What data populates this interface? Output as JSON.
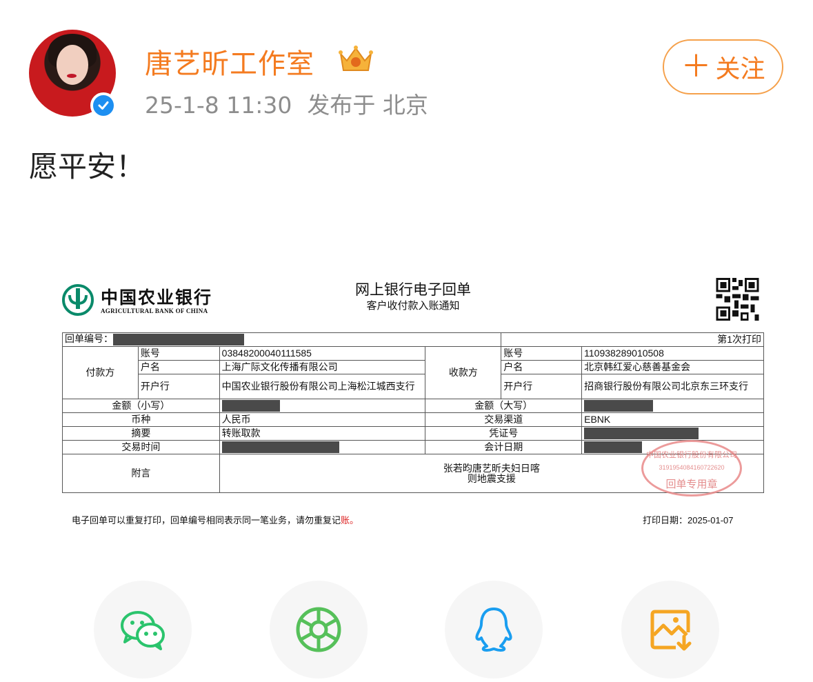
{
  "post": {
    "username": "唐艺昕工作室",
    "date": "25-1-8 11:30",
    "location": "发布于 北京",
    "follow_label": "关注",
    "follow_plus": "＋",
    "text": "愿平安！"
  },
  "icons": {
    "verified": "verified-badge-icon",
    "crown": "crown-badge-icon",
    "share": [
      "wechat-icon",
      "moments-icon",
      "qq-icon",
      "save-image-icon"
    ]
  },
  "colors": {
    "username": "#f47b20",
    "verified": "#1d8ff1",
    "wechat": "#2bc46d",
    "moments": "#56c05a",
    "qq": "#1a9ef0",
    "save": "#f5a623"
  },
  "receipt": {
    "bank_cn": "中国农业银行",
    "bank_en": "AGRICULTURAL BANK OF CHINA",
    "title": "网上银行电子回单",
    "subtitle": "客户收付款入账通知",
    "receipt_no_label": "回单编号：",
    "print_count": "第1次打印",
    "payer_label": "付款方",
    "payee_label": "收款方",
    "account_label": "账号",
    "name_label": "户名",
    "bank_label": "开户行",
    "payer": {
      "account": "03848200040111585",
      "name": "上海广际文化传播有限公司",
      "bank": "中国农业银行股份有限公司上海松江城西支行"
    },
    "payee": {
      "account": "110938289010508",
      "name": "北京韩红爱心慈善基金会",
      "bank": "招商银行股份有限公司北京东三环支行"
    },
    "amount_small_label": "金额（小写）",
    "amount_big_label": "金额（大写）",
    "currency_label": "币种",
    "currency": "人民币",
    "channel_label": "交易渠道",
    "channel": "EBNK",
    "summary_label": "摘要",
    "summary": "转账取款",
    "voucher_label": "凭证号",
    "time_label": "交易时间",
    "accounting_date_label": "会计日期",
    "note_label": "附言",
    "note_line1": "张若昀唐艺昕夫妇日喀",
    "note_line2": "则地震支援",
    "stamp_line1": "中国农业银行股份有限公司",
    "stamp_line2": "3191954084160722620",
    "stamp_line3": "回单专用章",
    "footer_left_1": "电子回单可以重复打印，回单编号相同表示同一笔业务，请勿重复记",
    "footer_left_2": "账。",
    "footer_right": "打印日期：2025-01-07"
  }
}
